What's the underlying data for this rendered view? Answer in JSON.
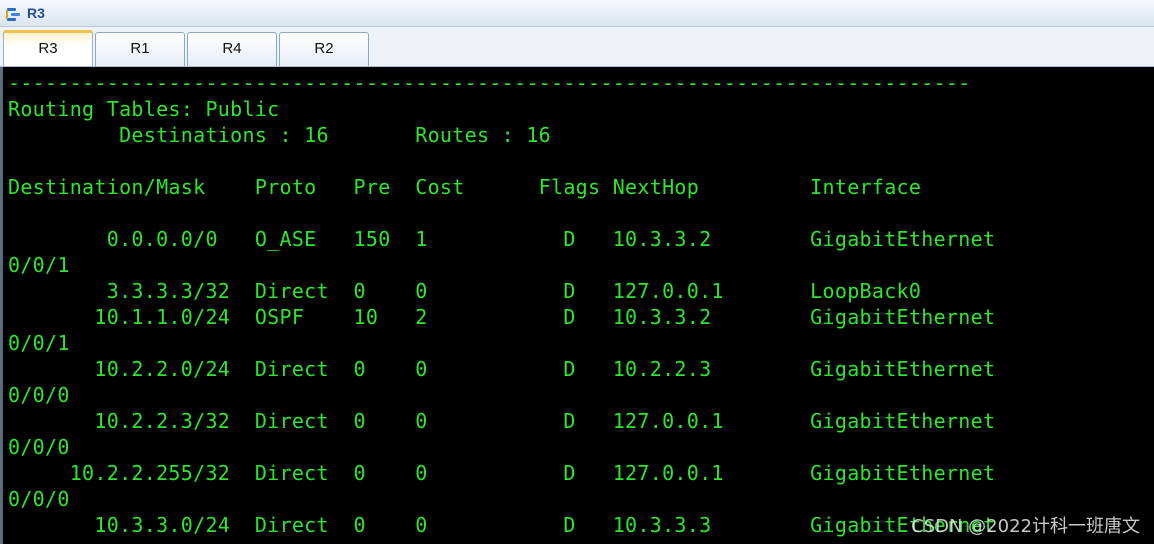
{
  "window": {
    "title": "R3",
    "icon": "router-app-icon"
  },
  "tabs": [
    {
      "label": "R3",
      "active": true
    },
    {
      "label": "R1",
      "active": false
    },
    {
      "label": "R4",
      "active": false
    },
    {
      "label": "R2",
      "active": false
    }
  ],
  "terminal": {
    "lines": [
      "------------------------------------------------------------------------------",
      "Routing Tables: Public",
      "         Destinations : 16       Routes : 16",
      "",
      "Destination/Mask    Proto   Pre  Cost      Flags NextHop         Interface",
      "",
      "        0.0.0.0/0   O_ASE   150  1           D   10.3.3.2        GigabitEthernet",
      "0/0/1",
      "        3.3.3.3/32  Direct  0    0           D   127.0.0.1       LoopBack0",
      "       10.1.1.0/24  OSPF    10   2           D   10.3.3.2        GigabitEthernet",
      "0/0/1",
      "       10.2.2.0/24  Direct  0    0           D   10.2.2.3        GigabitEthernet",
      "0/0/0",
      "       10.2.2.3/32  Direct  0    0           D   127.0.0.1       GigabitEthernet",
      "0/0/0",
      "     10.2.2.255/32  Direct  0    0           D   127.0.0.1       GigabitEthernet",
      "0/0/0",
      "       10.3.3.0/24  Direct  0    0           D   10.3.3.3        GigabitEthernet"
    ],
    "text_color": "#2ee52e",
    "background": "#000000"
  },
  "watermark": "CSDN @2022计科一班唐文"
}
